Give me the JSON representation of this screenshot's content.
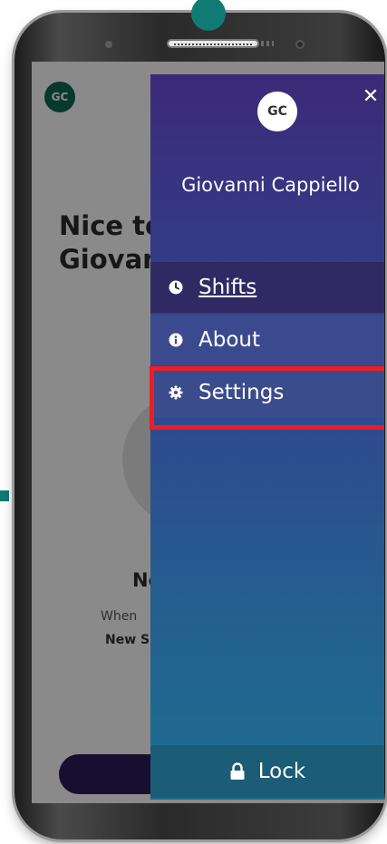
{
  "background_app": {
    "avatar_initials": "GC",
    "greeting_line1": "Nice to",
    "greeting_line2": "Giovan",
    "empty_heading": "No",
    "empty_text1": "When",
    "empty_text2": "New S"
  },
  "drawer": {
    "avatar_initials": "GC",
    "close_icon": "close-icon",
    "user_name": "Giovanni Cappiello",
    "menu_items": [
      {
        "label": "Shifts",
        "icon": "clock-icon",
        "active": true
      },
      {
        "label": "About",
        "icon": "info-icon"
      },
      {
        "label": "Settings",
        "icon": "gear-icon",
        "highlighted": true
      }
    ],
    "lock_label": "Lock",
    "lock_icon": "lock-icon"
  },
  "colors": {
    "drawer_top": "#3c2a78",
    "drawer_bottom": "#1d6e8f",
    "highlight": "#ee1c24",
    "accent_teal": "#127a74"
  }
}
